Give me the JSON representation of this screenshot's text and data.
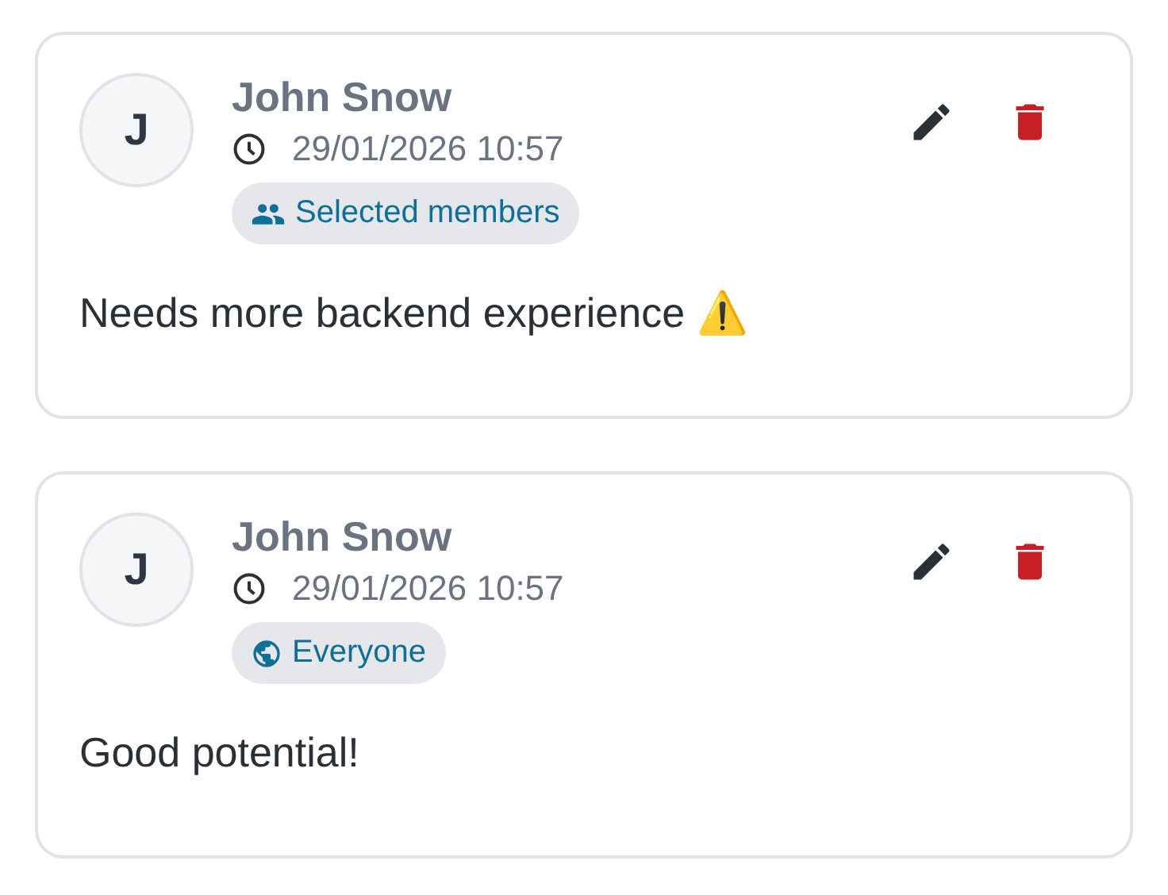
{
  "comments": [
    {
      "avatar": "J",
      "author": "John Snow",
      "timestamp": "29/01/2026 10:57",
      "audience": {
        "kind": "members",
        "label": "Selected members"
      },
      "text": "Needs more backend experience ⚠️"
    },
    {
      "avatar": "J",
      "author": "John Snow",
      "timestamp": "29/01/2026 10:57",
      "audience": {
        "kind": "everyone",
        "label": "Everyone"
      },
      "text": "Good potential!"
    }
  ]
}
